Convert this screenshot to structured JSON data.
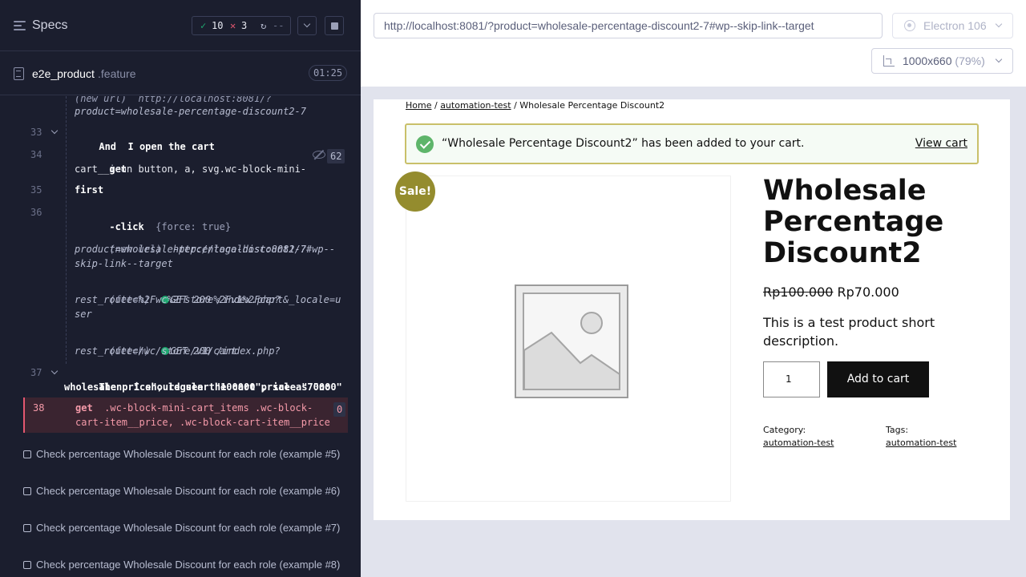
{
  "reporter": {
    "header": {
      "title": "Specs",
      "passed": "10",
      "failed": "3",
      "pending": "--",
      "pass_icon": "✓",
      "fail_icon": "✕",
      "pending_icon": "↻"
    },
    "spec": {
      "name": "e2e_product",
      "ext": ".feature",
      "duration": "01:25"
    },
    "commands": {
      "url_top": "(new url)  http://localhost:8081/?",
      "url_top_cont": "product=wholesale-percentage-discount2-7",
      "c33_num": "33",
      "c33_kw": "And",
      "c33_text": "I open the cart",
      "c34_num": "34",
      "c34_cmd": "get",
      "c34_arg1": "button, a, svg.wc-block-mini-",
      "c34_arg2": "cart__icon",
      "c34_count": "62",
      "c35_num": "35",
      "c35_cmd": "first",
      "c36_num": "36",
      "c36_cmd": "-click",
      "c36_arg": "{force: true}",
      "nu_label": "(new url)",
      "nu_1": "http://localhost:8081/?",
      "nu_2": "product=wholesale-percentage-discount2-7#wp--",
      "nu_3": "skip-link--target",
      "f1_label": "(fetch)",
      "f1_method": "GET 200 /index.php?",
      "f1_2": "rest_route=%2Fwc%2Fstore%2Fv1%2Fcart&_locale=u",
      "f1_3": "ser",
      "f2_label": "(fetch)",
      "f2_method": "GET 200 /index.php?",
      "f2_2": "rest_route=/wc/store/v1/cart",
      "c37_num": "37",
      "c37_kw": "Then",
      "c37_text1": "I should see the cart price as \"no",
      "c37_text2": "wholesale price\", regular \"100000\", sale \"70000\"",
      "c38_num": "38",
      "c38_cmd": "get",
      "c38_arg1": ".wc-block-mini-cart_items .wc-block-",
      "c38_arg2": "cart-item__price, .wc-block-cart-item__price",
      "c38_count": "0"
    },
    "tests": [
      {
        "title": "Check percentage Wholesale Discount for each role (example #5)"
      },
      {
        "title": "Check percentage Wholesale Discount for each role (example #6)"
      },
      {
        "title": "Check percentage Wholesale Discount for each role (example #7)"
      },
      {
        "title": "Check percentage Wholesale Discount for each role (example #8)"
      }
    ]
  },
  "runner": {
    "url": "http://localhost:8081/?product=wholesale-percentage-discount2-7#wp--skip-link--target",
    "browser": "Electron 106",
    "viewport": "1000x660",
    "viewport_pct": "(79%)"
  },
  "site": {
    "breadcrumb": {
      "home": "Home",
      "sep1": " / ",
      "category": "automation-test",
      "sep2": " / ",
      "current": "Wholesale Percentage Discount2"
    },
    "notice": {
      "text": "“Wholesale Percentage Discount2” has been added to your cart.",
      "action": "View cart"
    },
    "sale_badge": "Sale!",
    "product": {
      "title": "Wholesale Percentage Discount2",
      "regular_price": "Rp100.000",
      "sale_price": "Rp70.000",
      "short_description": "This is a test product short description.",
      "quantity": "1",
      "add_to_cart": "Add to cart",
      "category_label": "Category:",
      "category": "automation-test",
      "tags_label": "Tags:",
      "tag": "automation-test"
    }
  }
}
